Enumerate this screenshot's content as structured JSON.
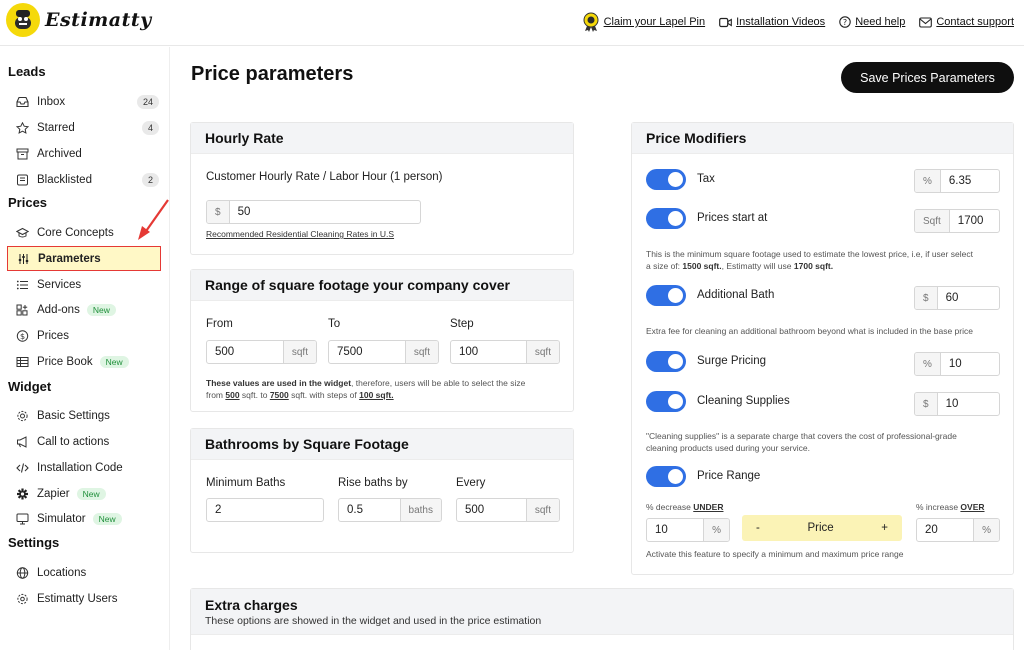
{
  "app": {
    "logo_text": "Estimatty"
  },
  "toplinks": [
    {
      "label": "Claim your Lapel Pin",
      "icon": "lapel-pin-icon"
    },
    {
      "label": "Installation Videos",
      "icon": "video-icon"
    },
    {
      "label": "Need help",
      "icon": "help-icon"
    },
    {
      "label": "Contact support",
      "icon": "mail-icon"
    }
  ],
  "sidebar": {
    "leads_title": "Leads",
    "leads": [
      {
        "label": "Inbox",
        "count": "24",
        "icon": "inbox-icon"
      },
      {
        "label": "Starred",
        "count": "4",
        "icon": "star-icon"
      },
      {
        "label": "Archived",
        "count": "",
        "icon": "archive-icon"
      },
      {
        "label": "Blacklisted",
        "count": "2",
        "icon": "blacklist-icon"
      }
    ],
    "prices_title": "Prices",
    "prices": [
      {
        "label": "Core Concepts",
        "icon": "graduation-cap-icon"
      },
      {
        "label": "Parameters",
        "icon": "sliders-icon",
        "active": true
      },
      {
        "label": "Services",
        "icon": "list-icon"
      },
      {
        "label": "Add-ons",
        "badge": "New",
        "icon": "addons-icon"
      },
      {
        "label": "Prices",
        "icon": "dollar-icon"
      },
      {
        "label": "Price Book",
        "badge": "New",
        "icon": "book-icon"
      }
    ],
    "widget_title": "Widget",
    "widget": [
      {
        "label": "Basic Settings",
        "icon": "gear-icon"
      },
      {
        "label": "Call to actions",
        "icon": "megaphone-icon"
      },
      {
        "label": "Installation Code",
        "icon": "code-icon"
      },
      {
        "label": "Zapier",
        "badge": "New",
        "icon": "zapier-icon"
      },
      {
        "label": "Simulator",
        "badge": "New",
        "icon": "monitor-icon"
      }
    ],
    "settings_title": "Settings",
    "settings": [
      {
        "label": "Locations",
        "icon": "globe-icon"
      },
      {
        "label": "Estimatty Users",
        "icon": "users-icon"
      }
    ]
  },
  "main": {
    "title": "Price parameters",
    "save_label": "Save Prices Parameters"
  },
  "hourly": {
    "title": "Hourly Rate",
    "label": "Customer Hourly Rate / Labor Hour (1 person)",
    "prefix": "$",
    "value": "50",
    "link": "Recommended Residential Cleaning Rates in U.S"
  },
  "range": {
    "title": "Range of square footage your company cover",
    "from_label": "From",
    "from_value": "500",
    "from_unit": "sqft",
    "to_label": "To",
    "to_value": "7500",
    "to_unit": "sqft",
    "step_label": "Step",
    "step_value": "100",
    "step_unit": "sqft",
    "note_bold": "These values are used in the widget",
    "note_text": ", therefore, users will be able to select the size",
    "note_from": "from ",
    "note_v1": "500",
    "note_mid1": " sqft. to ",
    "note_v2": "7500",
    "note_mid2": " sqft. with steps of ",
    "note_v3": "100 sqft."
  },
  "baths": {
    "title": "Bathrooms by Square Footage",
    "min_label": "Minimum Baths",
    "min_value": "2",
    "rise_label": "Rise baths by",
    "rise_value": "0.5",
    "rise_unit": "baths",
    "every_label": "Every",
    "every_value": "500",
    "every_unit": "sqft"
  },
  "extra": {
    "title": "Extra charges",
    "subtitle": "These options are showed in the widget and used in the price estimation"
  },
  "modifiers": {
    "title": "Price Modifiers",
    "tax_label": "Tax",
    "tax_unit": "%",
    "tax_value": "6.35",
    "start_label": "Prices start at",
    "start_unit": "Sqft",
    "start_value": "1700",
    "start_note_a": "This is the minimum square footage used to estimate the lowest price, i.e, if user select",
    "start_note_b1": "a size of: ",
    "start_note_b2": "1500 sqft.",
    "start_note_b3": ", Estimatty will use ",
    "start_note_b4": "1700 sqft.",
    "bath_label": "Additional Bath",
    "bath_unit": "$",
    "bath_value": "60",
    "bath_note": "Extra fee for cleaning an additional bathroom beyond what is included in the base price",
    "surge_label": "Surge Pricing",
    "surge_unit": "%",
    "surge_value": "10",
    "supplies_label": "Cleaning Supplies",
    "supplies_unit": "$",
    "supplies_value": "10",
    "supplies_note_a": "\"Cleaning supplies\" is a separate charge that covers the cost of professional-grade",
    "supplies_note_b": "cleaning products used during your service.",
    "range_label": "Price Range",
    "decrease_label": "% decrease ",
    "decrease_word": "UNDER",
    "increase_label": "% increase ",
    "increase_word": "OVER",
    "decrease_value": "10",
    "decrease_unit": "%",
    "increase_value": "20",
    "increase_unit": "%",
    "pill_minus": "-",
    "pill_label": "Price",
    "pill_plus": "+",
    "range_note": "Activate this feature to specify a minimum and maximum price range"
  }
}
